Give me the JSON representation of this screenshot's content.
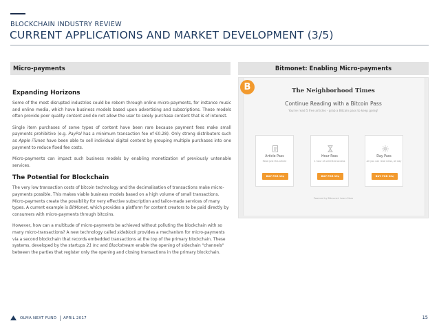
{
  "header": {
    "section_label": "BLOCKCHAIN INDUSTRY REVIEW",
    "title": "CURRENT APPLICATIONS AND MARKET DEVELOPMENT (3/5)"
  },
  "left_panel": {
    "header": "Micro-payments",
    "heading1": "Expanding Horizons",
    "p1": "Some of the most disrupted industries could be reborn through online micro-payments, for instance music and online media, which have business models based upon advertising and subscriptions. These models often provide poor quality content and do not allow the user to solely purchase content that is of interest.",
    "p2_a": "Single item purchases of some types of content have been rare because payment fees make small payments prohibitive (e.g. ",
    "p2_paypal": "PayPal",
    "p2_b": " has a minimum transaction fee of €0.28). Only strong distributors such as ",
    "p2_itunes": "Apple iTunes",
    "p2_c": " have been able to sell individual digital content by grouping multiple purchases into one payment to reduce fixed fee costs.",
    "p3": "Micro-payments can impact such business models by enabling monetization of previously untenable services.",
    "heading2": "The Potential for Blockchain",
    "p4_a": "The very low transaction costs of bitcoin technology and the decimalisation of transactions make micro-payments possible. This makes viable business models based on a high volume of small transactions. Micro-payments create the possibility for very effective subscription and tailor-made services of many types. A current example is ",
    "p4_bitmonet": "BitMonet",
    "p4_b": ", which provides a platform for content creators to be paid directly by consumers with micro-payments through bitcoins.",
    "p5_a": "However, how can a multitude of micro-payments be achieved without polluting the blockchain with so many micro-transactions? A new technology called ",
    "p5_sideblock": "sideblock",
    "p5_b": " provides a mechanism for micro-payments via a second blockchain that records embedded transactions at the top of the primary blockchain. These systems, developed by the startups ",
    "p5_21inc": "21 Inc",
    "p5_c": " and ",
    "p5_blockstream": "Blockstream",
    "p5_d": " enable the opening of sidechain \"channels\" between the parties that register only the opening and closing transactions in the primary blockchain."
  },
  "right_panel": {
    "header": "Bitmonet: Enabling Micro-payments",
    "screenshot": {
      "logo_letter": "B",
      "paper_name": "The Neighborhood Times",
      "heading": "Continue Reading with a Bitcoin Pass",
      "note": "You've read 5 free articles - grab a Bitcoin pass to keep going!",
      "passes": [
        {
          "name": "Article Pass",
          "desc": "Read just this article",
          "button": "BUY FOR 10¢",
          "icon": "document-icon"
        },
        {
          "name": "Hour Pass",
          "desc": "1 hour of unlimited access",
          "button": "BUY FOR 15¢",
          "icon": "hourglass-icon"
        },
        {
          "name": "Day Pass",
          "desc": "All you can read news, all day",
          "button": "BUY FOR 20¢",
          "icon": "sun-icon"
        }
      ],
      "powered_by": "Powered by Bitmonet. Learn More"
    }
  },
  "footer": {
    "brand": "OLMA NEXT FUND",
    "date": "APRIL 2017",
    "page_number": "15"
  },
  "colors": {
    "title_blue": "#1e3a5f",
    "panel_header_grey": "#e3e3e3",
    "bitmonet_orange": "#f29a2e"
  }
}
